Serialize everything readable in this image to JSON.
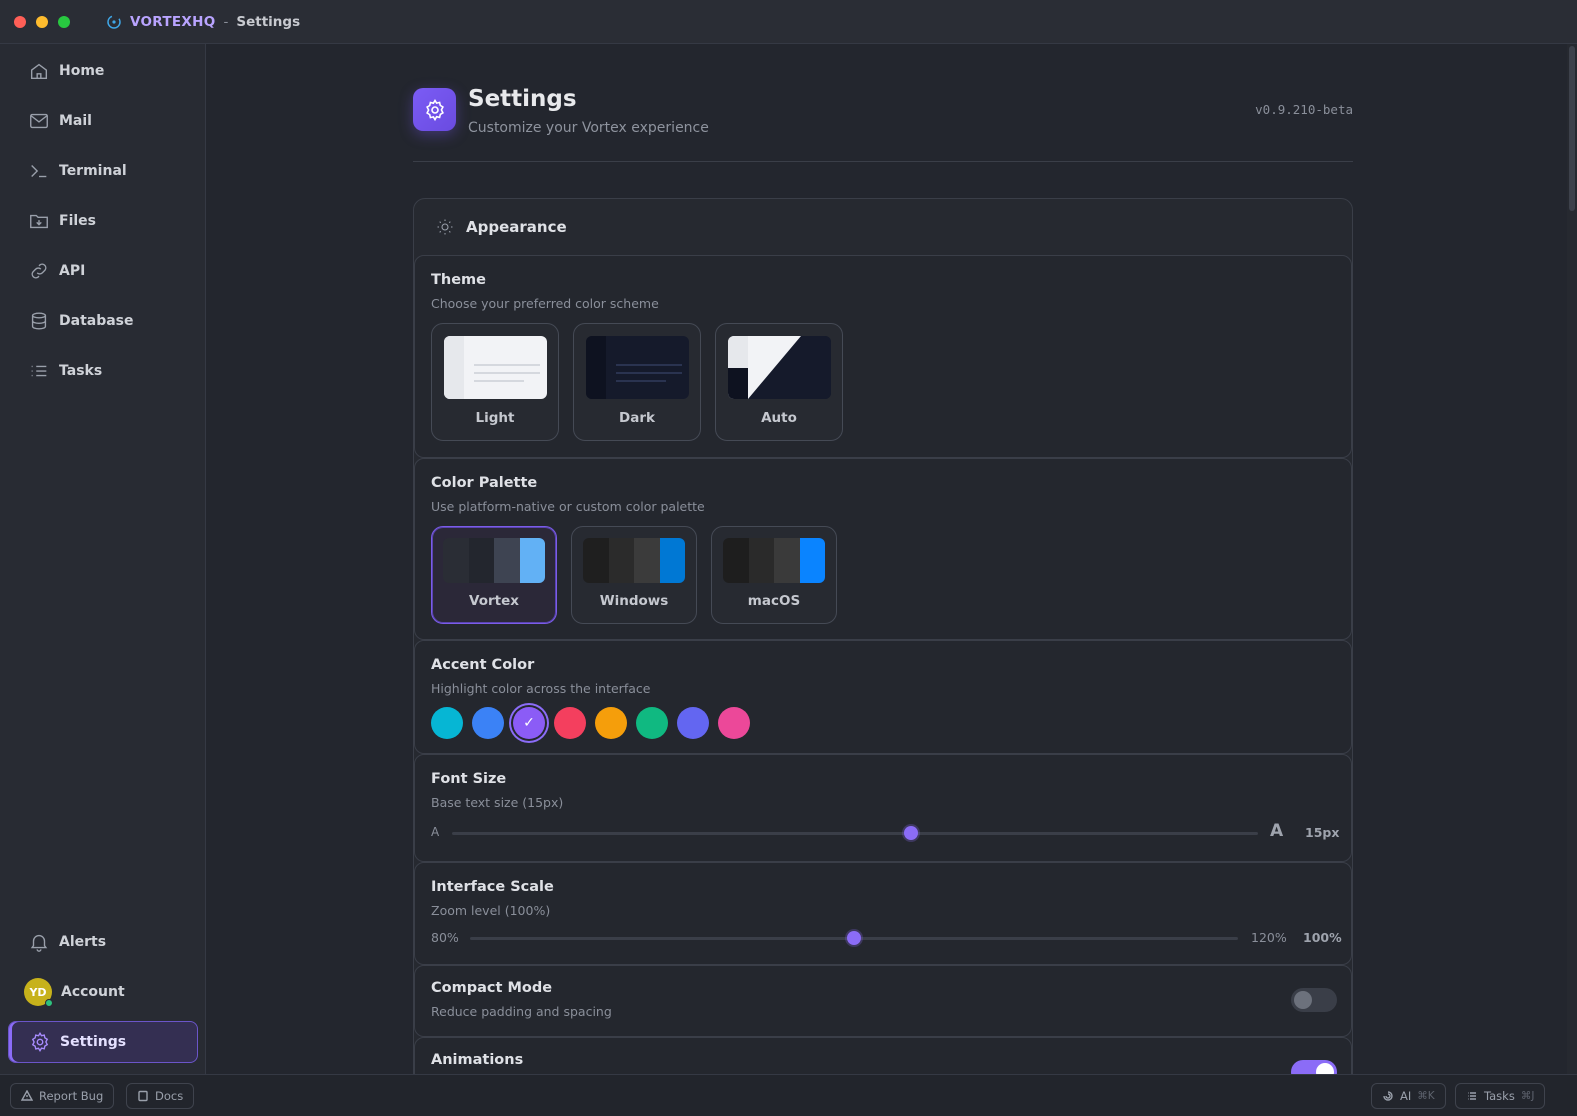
{
  "window": {
    "brand": "VORTEXHQ",
    "separator": "-",
    "title": "Settings"
  },
  "sidebar": {
    "items": [
      {
        "label": "Home",
        "icon": "home-icon"
      },
      {
        "label": "Mail",
        "icon": "mail-icon"
      },
      {
        "label": "Terminal",
        "icon": "terminal-icon"
      },
      {
        "label": "Files",
        "icon": "folder-download-icon"
      },
      {
        "label": "API",
        "icon": "link-icon"
      },
      {
        "label": "Database",
        "icon": "database-icon"
      },
      {
        "label": "Tasks",
        "icon": "list-icon"
      }
    ],
    "bottom": {
      "alerts": "Alerts",
      "account": "Account",
      "avatar_initials": "YD",
      "settings": "Settings"
    }
  },
  "header": {
    "title": "Settings",
    "subtitle": "Customize your Vortex experience",
    "version": "v0.9.210-beta"
  },
  "appearance": {
    "title": "Appearance",
    "theme": {
      "title": "Theme",
      "subtitle": "Choose your preferred color scheme",
      "options": [
        "Light",
        "Dark",
        "Auto"
      ]
    },
    "palette": {
      "title": "Color Palette",
      "subtitle": "Use platform-native or custom color palette",
      "options": [
        {
          "label": "Vortex",
          "selected": true,
          "colors": [
            "#2a2d35",
            "#23262e",
            "#3e4452",
            "#62b1f5"
          ]
        },
        {
          "label": "Windows",
          "selected": false,
          "colors": [
            "#1f1f1f",
            "#2b2b2b",
            "#3b3b3b",
            "#0078d4"
          ]
        },
        {
          "label": "macOS",
          "selected": false,
          "colors": [
            "#1e1e1e",
            "#2a2a2a",
            "#3a3a3a",
            "#0a84ff"
          ]
        }
      ]
    },
    "accent": {
      "title": "Accent Color",
      "subtitle": "Highlight color across the interface",
      "colors": [
        "#06b6d4",
        "#3b82f6",
        "#8b5cf6",
        "#f43f5e",
        "#f59e0b",
        "#10b981",
        "#6366f1",
        "#ec4899"
      ],
      "selected_index": 2
    },
    "font_size": {
      "title": "Font Size",
      "subtitle": "Base text size (15px)",
      "min_label": "A",
      "max_label": "A",
      "value_label": "15px",
      "fraction": 0.57
    },
    "scale": {
      "title": "Interface Scale",
      "subtitle": "Zoom level (100%)",
      "min_label": "80%",
      "max_label": "120%",
      "value_label": "100%",
      "fraction": 0.5
    },
    "compact": {
      "title": "Compact Mode",
      "subtitle": "Reduce padding and spacing",
      "on": false
    },
    "animations": {
      "title": "Animations",
      "on": true
    }
  },
  "statusbar": {
    "report_bug": "Report Bug",
    "docs": "Docs",
    "ai": "AI",
    "ai_kbd": "⌘K",
    "tasks": "Tasks",
    "tasks_kbd": "⌘J"
  }
}
